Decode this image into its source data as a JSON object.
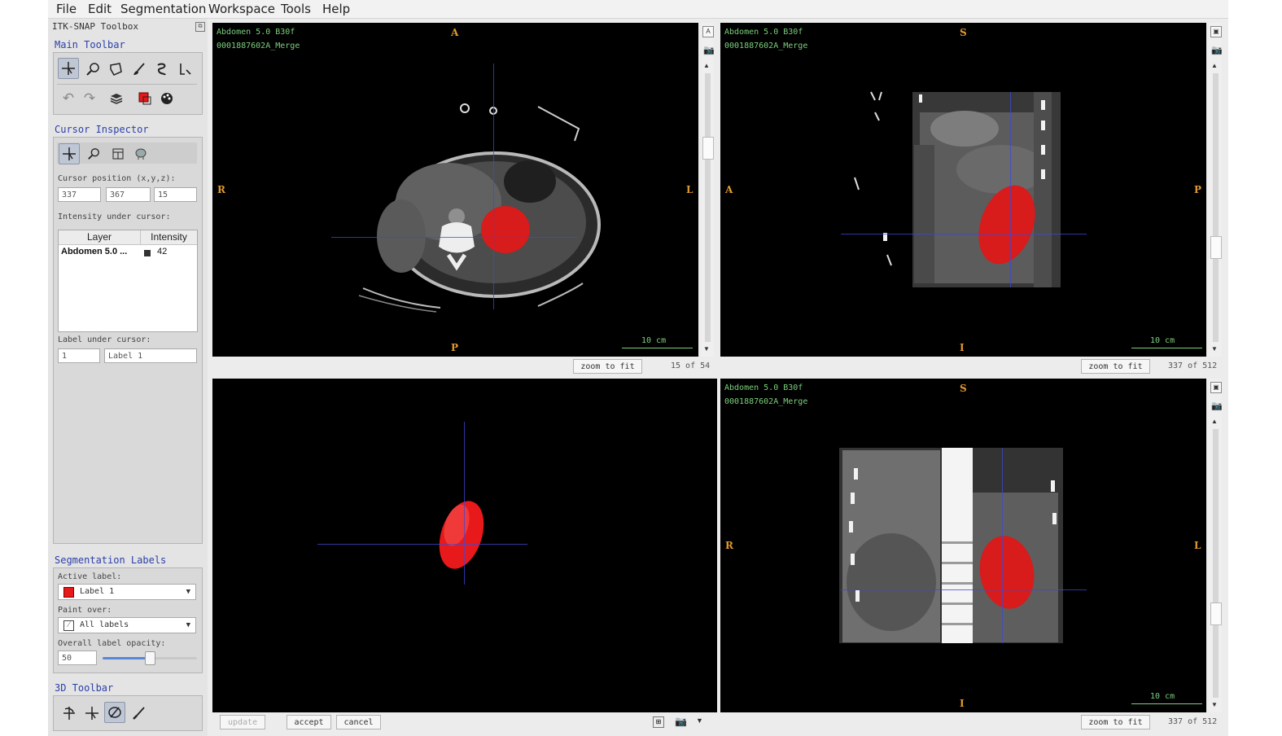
{
  "menu": [
    "File",
    "Edit",
    "Segmentation",
    "Workspace",
    "Tools",
    "Help"
  ],
  "toolbox": {
    "title": "ITK-SNAP Toolbox",
    "main_toolbar_title": "Main Toolbar",
    "cursor_inspector_title": "Cursor Inspector",
    "cursor_position_label": "Cursor position (x,y,z):",
    "cursor_x": "337",
    "cursor_y": "367",
    "cursor_z": "15",
    "intensity_label": "Intensity under cursor:",
    "table_headers": [
      "Layer",
      "Intensity"
    ],
    "table_rows": [
      {
        "layer": "Abdomen 5.0 ...",
        "intensity": "42"
      }
    ],
    "label_under_cursor_label": "Label under cursor:",
    "label_id": "1",
    "label_name": "Label 1",
    "seg_labels_title": "Segmentation Labels",
    "active_label_label": "Active label:",
    "active_label_value": "Label 1",
    "paint_over_label": "Paint over:",
    "paint_over_value": "All labels",
    "opacity_label": "Overall label opacity:",
    "opacity_value": "50",
    "opacity_fraction": 0.5,
    "toolbar3d_title": "3D Toolbar"
  },
  "views": {
    "axial": {
      "line1": "Abdomen  5.0  B30f",
      "line2": "0001887602A_Merge",
      "top": "A",
      "bottom": "P",
      "left": "R",
      "right": "L",
      "scale": "10 cm",
      "zoom_button": "zoom to fit",
      "slice": "15 of 54"
    },
    "sagittal": {
      "line1": "Abdomen  5.0  B30f",
      "line2": "0001887602A_Merge",
      "top": "S",
      "bottom": "I",
      "left": "A",
      "right": "P",
      "scale": "10 cm",
      "zoom_button": "zoom to fit",
      "slice": "337 of 512"
    },
    "render3d": {
      "update_button": "update",
      "accept_button": "accept",
      "cancel_button": "cancel"
    },
    "coronal": {
      "line1": "Abdomen  5.0  B30f",
      "line2": "0001887602A_Merge",
      "top": "S",
      "bottom": "I",
      "left": "R",
      "right": "L",
      "scale": "10 cm",
      "zoom_button": "zoom to fit",
      "slice": "337 of 512"
    }
  },
  "colors": {
    "label1": "#e8191a",
    "accent": "#2b3fa8",
    "overlay": "#7cd07c",
    "orientation": "#e09a2f",
    "crosshair": "#3c48d8"
  },
  "icons": [
    "crosshair-icon",
    "zoom-icon",
    "polygon-icon",
    "paintbrush-icon",
    "snake-icon",
    "annotation-icon",
    "undo-icon",
    "redo-icon",
    "layers-icon",
    "label-color-icon",
    "palette-icon",
    "camera-icon",
    "layout-icon",
    "chevron-down-icon"
  ]
}
